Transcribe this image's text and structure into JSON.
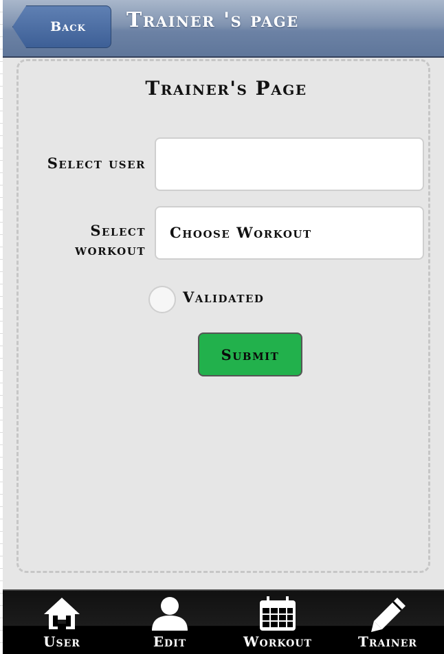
{
  "header": {
    "back_label": "Back",
    "title": "Trainer 's page"
  },
  "main": {
    "heading": "Trainer's Page",
    "select_user_label": "Select user",
    "select_user_value": "",
    "select_workout_label_line1": "Select",
    "select_workout_label_line2": "workout",
    "select_workout_value": "Choose Workout",
    "validated_label": "Validated",
    "submit_label": "Submit"
  },
  "nav": {
    "items": [
      {
        "label": "User",
        "icon": "home-icon"
      },
      {
        "label": "Edit",
        "icon": "person-icon"
      },
      {
        "label": "Workout",
        "icon": "calendar-icon"
      },
      {
        "label": "Trainer",
        "icon": "pencil-icon"
      }
    ]
  },
  "colors": {
    "header": "#6c82a5",
    "back_button": "#3d5f96",
    "submit": "#22b14c",
    "footer": "#000000"
  }
}
